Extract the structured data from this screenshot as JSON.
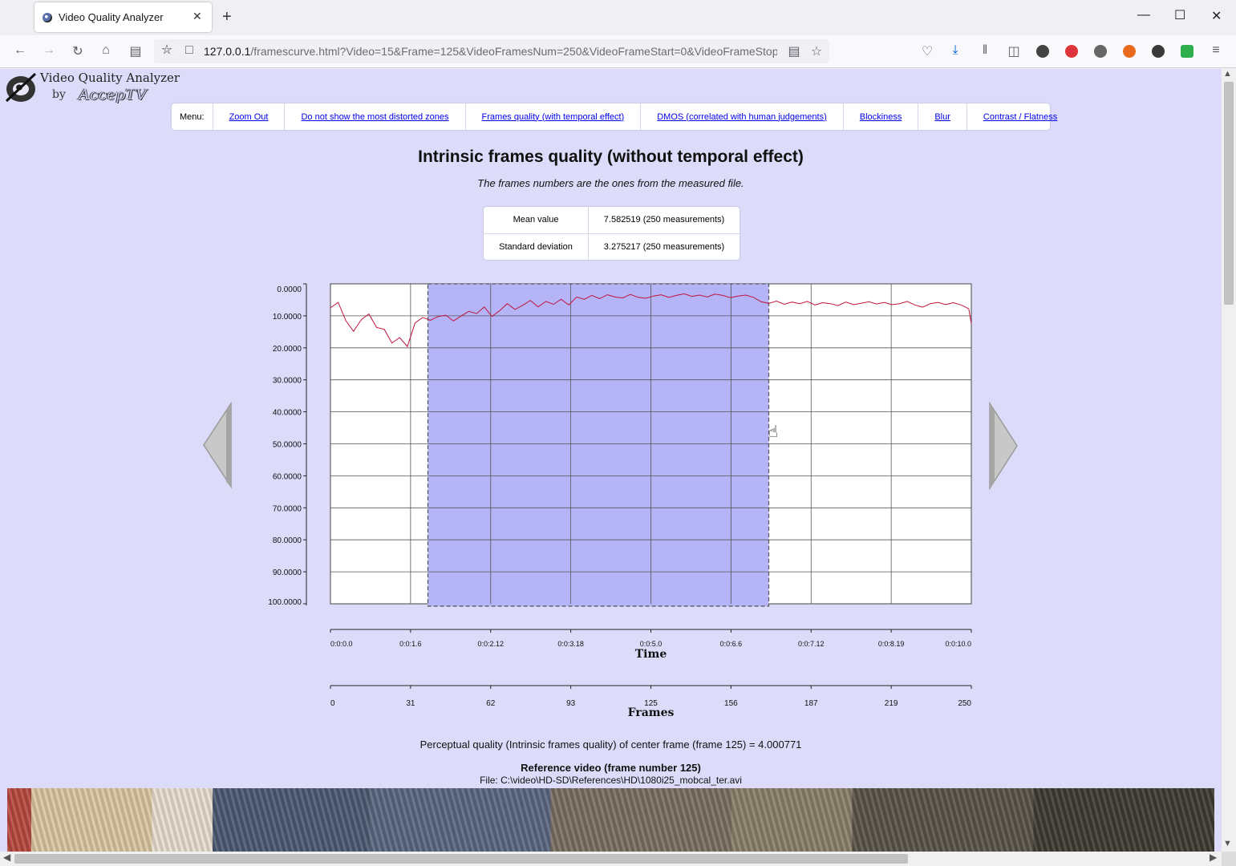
{
  "browser": {
    "tab_title": "Video Quality Analyzer",
    "tab_close": "✕",
    "new_tab": "+",
    "url_host": "127.0.0.1",
    "url_rest": "/framescurve.html?Video=15&Frame=125&VideoFramesNum=250&VideoFrameStart=0&VideoFrameStop="
  },
  "logo": {
    "line1": "Video Quality Analyzer",
    "by": "by",
    "brand": "AccepTV"
  },
  "menu": {
    "label": "Menu:",
    "items": [
      "Zoom Out",
      "Do not show the most distorted zones",
      "Frames quality (with temporal effect)",
      "DMOS (correlated with human judgements)",
      "Blockiness",
      "Blur",
      "Contrast / Flatness"
    ]
  },
  "title": "Intrinsic frames quality (without temporal effect)",
  "subtitle": "The frames numbers are the ones from the measured file.",
  "stats": {
    "mean_label": "Mean value",
    "mean_value": "7.582519 (250 measurements)",
    "std_label": "Standard deviation",
    "std_value": "3.275217 (250 measurements)"
  },
  "chart_data": {
    "type": "line",
    "y_axis_inverted": true,
    "ylim": [
      0,
      100
    ],
    "y_ticks": [
      "0.0000",
      "10.0000",
      "20.0000",
      "30.0000",
      "40.0000",
      "50.0000",
      "60.0000",
      "70.0000",
      "80.0000",
      "90.0000",
      "100.0000"
    ],
    "time_ticks": [
      "0:0:0.0",
      "0:0:1.6",
      "0:0:2.12",
      "0:0:3.18",
      "0:0:5.0",
      "0:0:6.6",
      "0:0:7.12",
      "0:0:8.19",
      "0:0:10.0"
    ],
    "time_label": "Time",
    "frame_ticks": [
      "0",
      "31",
      "62",
      "93",
      "125",
      "156",
      "187",
      "219",
      "250"
    ],
    "frame_label": "Frames",
    "selection_frames": [
      38,
      171
    ],
    "xlim": [
      0,
      250
    ],
    "series_color": "#c0143c",
    "selection_color": "#b4b4f6",
    "x": [
      0,
      3,
      6,
      9,
      12,
      15,
      18,
      21,
      24,
      27,
      30,
      33,
      36,
      39,
      42,
      45,
      48,
      51,
      54,
      57,
      60,
      63,
      66,
      69,
      72,
      75,
      78,
      81,
      84,
      87,
      90,
      93,
      96,
      99,
      102,
      105,
      108,
      111,
      114,
      117,
      120,
      123,
      126,
      129,
      132,
      135,
      138,
      141,
      144,
      147,
      150,
      153,
      156,
      159,
      162,
      165,
      168,
      171,
      174,
      177,
      180,
      183,
      186,
      189,
      192,
      195,
      198,
      201,
      204,
      207,
      210,
      213,
      216,
      219,
      222,
      225,
      228,
      231,
      234,
      237,
      240,
      243,
      246,
      249,
      250
    ],
    "y": [
      7.5,
      5.8,
      11.5,
      14.8,
      11.2,
      9.4,
      13.6,
      14.2,
      18.5,
      16.8,
      19.6,
      12.2,
      10.5,
      11.4,
      10.2,
      9.8,
      11.6,
      10.0,
      8.6,
      9.3,
      7.2,
      10.2,
      8.4,
      6.2,
      8.0,
      6.7,
      5.2,
      7.2,
      5.5,
      6.4,
      4.8,
      6.6,
      4.1,
      4.8,
      3.6,
      4.6,
      3.4,
      4.1,
      4.4,
      3.3,
      4.2,
      4.5,
      3.8,
      3.4,
      4.2,
      3.6,
      3.1,
      3.9,
      3.5,
      4.1,
      3.2,
      3.6,
      4.3,
      3.8,
      3.5,
      4.2,
      5.6,
      6.1,
      5.4,
      6.4,
      5.7,
      6.2,
      5.5,
      6.6,
      5.9,
      6.2,
      6.8,
      5.7,
      6.5,
      6.1,
      5.6,
      6.3,
      5.8,
      6.5,
      6.2,
      5.5,
      6.6,
      7.3,
      6.2,
      5.8,
      6.5,
      5.9,
      6.6,
      7.8,
      12.4
    ]
  },
  "perceptual_text": "Perceptual quality (Intrinsic frames quality) of center frame (frame 125) = 4.000771",
  "reference": {
    "title": "Reference video (frame number 125)",
    "file": "File: C:\\video\\HD-SD\\References\\HD\\1080i25_mobcal_ter.avi"
  }
}
